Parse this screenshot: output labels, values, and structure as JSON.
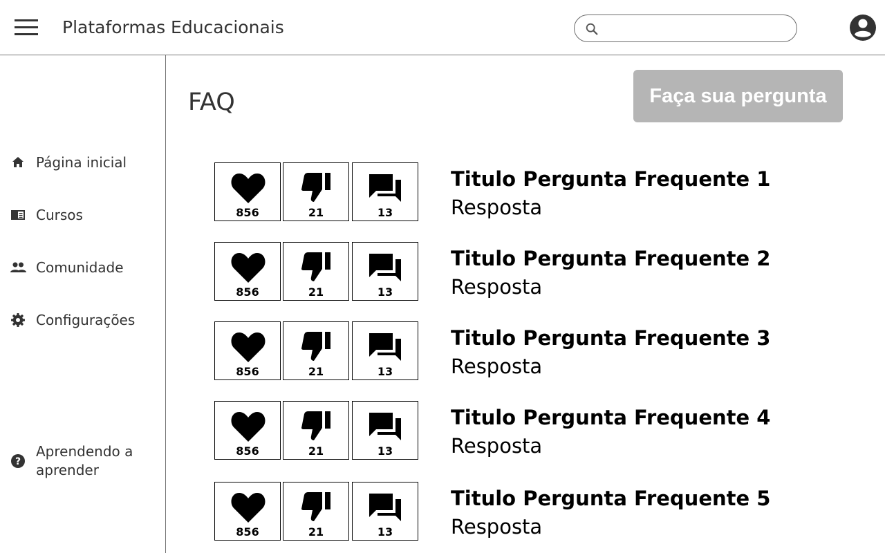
{
  "header": {
    "app_title": "Plataformas Educacionais",
    "search_placeholder": ""
  },
  "sidebar": {
    "items": [
      {
        "label": "Página inicial",
        "icon": "home-icon"
      },
      {
        "label": "Cursos",
        "icon": "book-icon"
      },
      {
        "label": "Comunidade",
        "icon": "people-icon"
      },
      {
        "label": "Configurações",
        "icon": "gear-icon"
      },
      {
        "label": "Aprendendo a aprender",
        "icon": "help-icon"
      }
    ]
  },
  "main": {
    "title": "FAQ",
    "ask_button": "Faça sua pergunta",
    "faqs": [
      {
        "title": "Titulo Pergunta Frequente 1",
        "answer": "Resposta",
        "likes": "856",
        "dislikes": "21",
        "comments": "13"
      },
      {
        "title": "Titulo Pergunta Frequente 2",
        "answer": "Resposta",
        "likes": "856",
        "dislikes": "21",
        "comments": "13"
      },
      {
        "title": "Titulo Pergunta Frequente 3",
        "answer": "Resposta",
        "likes": "856",
        "dislikes": "21",
        "comments": "13"
      },
      {
        "title": "Titulo Pergunta Frequente 4",
        "answer": "Resposta",
        "likes": "856",
        "dislikes": "21",
        "comments": "13"
      },
      {
        "title": "Titulo Pergunta Frequente 5",
        "answer": "Resposta",
        "likes": "856",
        "dislikes": "21",
        "comments": "13"
      }
    ]
  },
  "colors": {
    "ask_button_bg": "#b5b5b5",
    "border": "#757575",
    "text": "#333333"
  }
}
